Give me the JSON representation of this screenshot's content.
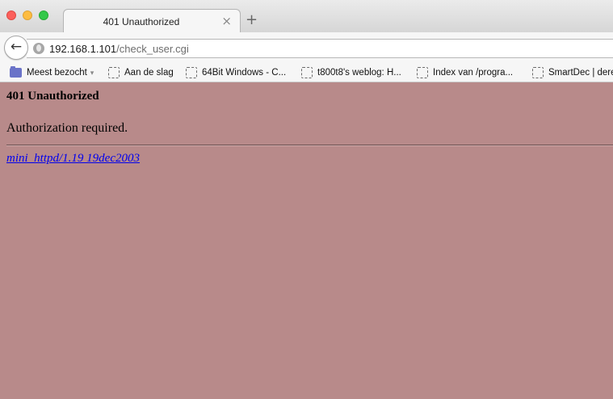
{
  "window": {
    "tab_title": "401 Unauthorized",
    "tab_close_glyph": "×",
    "new_tab_glyph": "+"
  },
  "navbar": {
    "back_glyph": "←",
    "url_host": "192.168.1.101",
    "url_path": "/check_user.cgi"
  },
  "bookmarks": {
    "items": [
      {
        "label": "Meest bezocht",
        "icon": "folder-icon",
        "has_caret": true
      },
      {
        "label": "Aan de slag",
        "icon": "page-icon"
      },
      {
        "label": "64Bit Windows - C...",
        "icon": "page-icon"
      },
      {
        "label": "t800t8's weblog: H...",
        "icon": "page-icon"
      },
      {
        "label": "Index van /progra...",
        "icon": "page-icon"
      },
      {
        "label": "SmartDec | dere",
        "icon": "page-icon"
      }
    ],
    "caret_glyph": "▾"
  },
  "page": {
    "heading": "401 Unauthorized",
    "message": "Authorization required.",
    "server_link": "mini_httpd/1.19 19dec2003",
    "background": "#b88a8a",
    "link_color": "#0000ee"
  }
}
